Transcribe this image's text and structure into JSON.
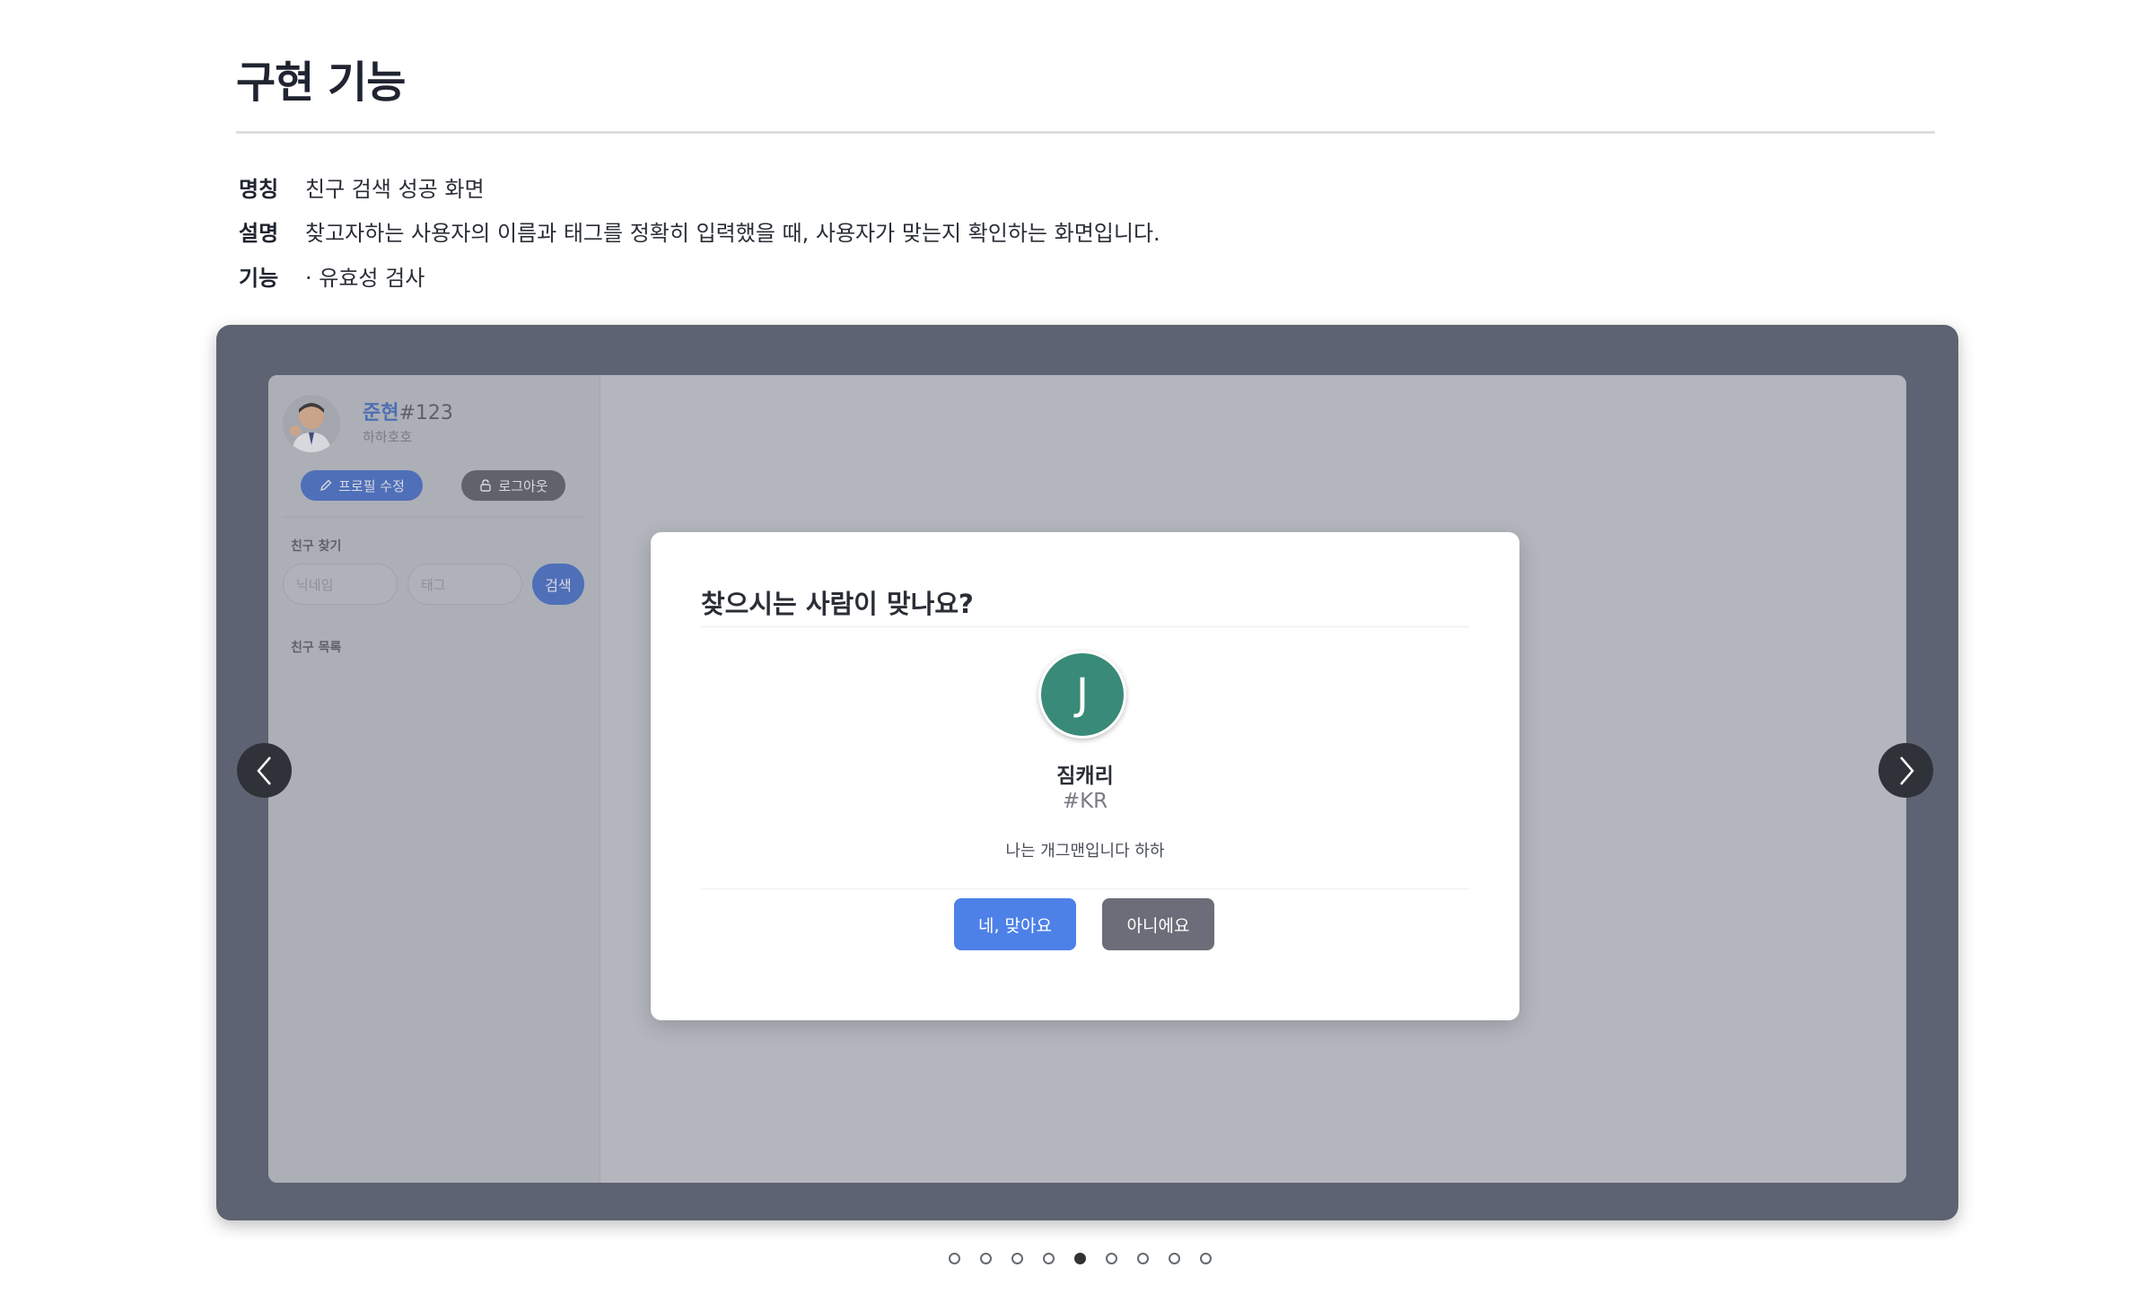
{
  "page": {
    "title": "구현 기능",
    "info": [
      {
        "key": "명칭",
        "value": "친구 검색 성공 화면"
      },
      {
        "key": "설명",
        "value": "찾고자하는 사용자의 이름과 태그를 정확히 입력했을 때, 사용자가 맞는지 확인하는 화면입니다."
      },
      {
        "key": "기능",
        "value": "· 유효성 검사"
      }
    ]
  },
  "sidebar": {
    "user": {
      "nickname": "준현",
      "tag": "#123",
      "status": "하하호호"
    },
    "edit_profile_label": "프로필 수정",
    "logout_label": "로그아웃",
    "find_friend_label": "친구 찾기",
    "nickname_placeholder": "닉네임",
    "tag_placeholder": "태그",
    "search_label": "검색",
    "friend_list_label": "친구 목록"
  },
  "modal": {
    "title": "찾으시는 사람이 맞나요?",
    "avatar_letter": "J",
    "avatar_color": "#3a8a79",
    "name": "짐캐리",
    "tag": "#KR",
    "status": "나는 개그맨입니다 하하",
    "confirm_label": "네, 맞아요",
    "cancel_label": "아니에요"
  },
  "carousel": {
    "total_slides": 9,
    "active_index": 5
  },
  "colors": {
    "accent": "#4d81e8",
    "slider_bg": "#5d6372",
    "screen_overlay": "#b4b6be"
  }
}
